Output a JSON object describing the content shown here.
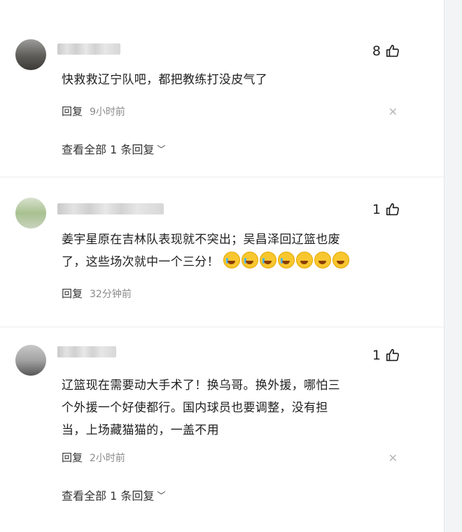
{
  "comments": [
    {
      "likes": "8",
      "text": "快救救辽宁队吧，都把教练打没皮气了",
      "reply_label": "回复",
      "time": "9小时前",
      "view_all": "查看全部 1 条回复"
    },
    {
      "likes": "1",
      "text_line1": "姜宇星原在吉林队表现就不突出；吴昌泽回辽篮也废",
      "text_line2": "了，这些场次就中一个三分！",
      "emojis": [
        "laughing-crying-emoji",
        "laughing-crying-emoji",
        "laughing-crying-emoji",
        "laughing-crying-emoji",
        "scared-emoji",
        "scared-emoji",
        "scared-emoji"
      ],
      "reply_label": "回复",
      "time": "32分钟前"
    },
    {
      "likes": "1",
      "text_line1": "辽篮现在需要动大手术了！换乌哥。换外援，哪怕三",
      "text_line2": "个外援一个好使都行。国内球员也要调整，没有担",
      "text_line3": "当，上场藏猫猫的，一盖不用",
      "reply_label": "回复",
      "time": "2小时前",
      "view_all": "查看全部 1 条回复"
    }
  ],
  "icons": {
    "like": "thumbs-up-icon",
    "close": "close-icon",
    "chevron": "chevron-down-icon"
  }
}
